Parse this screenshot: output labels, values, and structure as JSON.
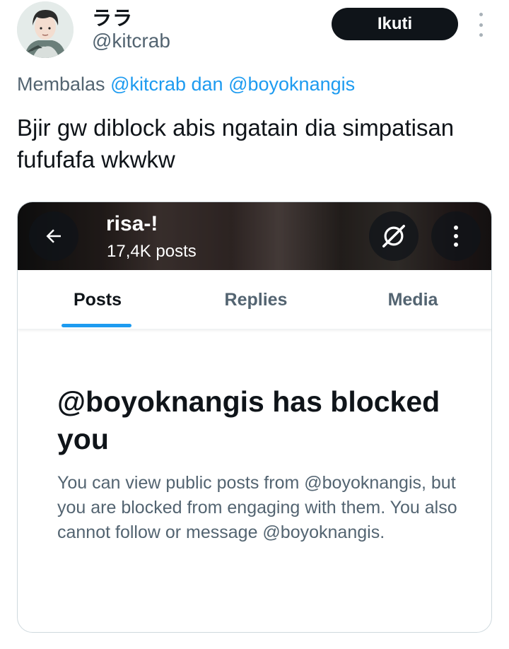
{
  "author": {
    "display_name": "ララ",
    "handle": "@kitcrab",
    "avatar_icon": "avatar-illustration"
  },
  "follow_label": "Ikuti",
  "more_icon": "more-vertical-icon",
  "reply_context": {
    "prefix": "Membalas",
    "mention_1": "@kitcrab",
    "conjunction": "dan",
    "mention_2": "@boyoknangis"
  },
  "tweet_text": "Bjir gw diblock abis ngatain dia simpatisan fufufafa wkwkw",
  "screenshot": {
    "profile_name": "risa-!",
    "post_count": "17,4K posts",
    "tabs": [
      {
        "label": "Posts",
        "active": true
      },
      {
        "label": "Replies",
        "active": false
      },
      {
        "label": "Media",
        "active": false
      }
    ],
    "blocked_title": "@boyoknangis has blocked you",
    "blocked_description": "You can view public posts from @boyoknangis, but you are blocked from engaging with them. You also cannot follow or message @boyoknangis.",
    "accent_color": "#1d9bf0"
  }
}
